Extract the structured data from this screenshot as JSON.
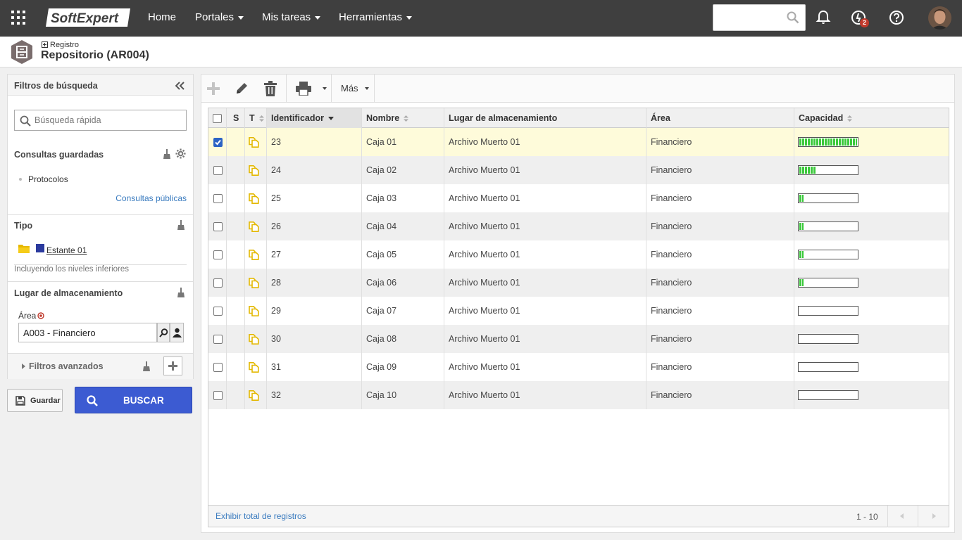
{
  "nav": {
    "logo": "SoftExpert",
    "items": [
      {
        "label": "Home",
        "dropdown": false
      },
      {
        "label": "Portales",
        "dropdown": true
      },
      {
        "label": "Mis tareas",
        "dropdown": true
      },
      {
        "label": "Herramientas",
        "dropdown": true
      }
    ],
    "search_value": "",
    "task_badge": "2"
  },
  "header": {
    "breadcrumb": "Registro",
    "title": "Repositorio (AR004)"
  },
  "sidebar": {
    "title": "Filtros de búsqueda",
    "quick_search_placeholder": "Búsqueda rápida",
    "saved_queries": {
      "title": "Consultas guardadas",
      "items": [
        "Protocolos"
      ],
      "public_link": "Consultas públicas"
    },
    "type": {
      "title": "Tipo",
      "item": "Estante 01",
      "item_color": "#2b3a9e",
      "note": "Incluyendo los niveles inferiores"
    },
    "storage": {
      "title": "Lugar de almacenamiento",
      "area_label": "Área",
      "area_value": "A003 - Financiero"
    },
    "advanced": "Filtros avanzados"
  },
  "buttons": {
    "save": "Guardar",
    "search": "BUSCAR"
  },
  "toolbar": {
    "more": "Más"
  },
  "grid": {
    "headers": {
      "s": "S",
      "t": "T",
      "id": "Identificador",
      "name": "Nombre",
      "location": "Lugar de almacenamiento",
      "area": "Área",
      "capacity": "Capacidad"
    },
    "rows": [
      {
        "checked": true,
        "id": "23",
        "name": "Caja 01",
        "location": "Archivo Muerto 01",
        "area": "Financiero",
        "capacity": 1.0
      },
      {
        "checked": false,
        "id": "24",
        "name": "Caja 02",
        "location": "Archivo Muerto 01",
        "area": "Financiero",
        "capacity": 0.28
      },
      {
        "checked": false,
        "id": "25",
        "name": "Caja 03",
        "location": "Archivo Muerto 01",
        "area": "Financiero",
        "capacity": 0.07
      },
      {
        "checked": false,
        "id": "26",
        "name": "Caja 04",
        "location": "Archivo Muerto 01",
        "area": "Financiero",
        "capacity": 0.07
      },
      {
        "checked": false,
        "id": "27",
        "name": "Caja 05",
        "location": "Archivo Muerto 01",
        "area": "Financiero",
        "capacity": 0.07
      },
      {
        "checked": false,
        "id": "28",
        "name": "Caja 06",
        "location": "Archivo Muerto 01",
        "area": "Financiero",
        "capacity": 0.07
      },
      {
        "checked": false,
        "id": "29",
        "name": "Caja 07",
        "location": "Archivo Muerto 01",
        "area": "Financiero",
        "capacity": 0
      },
      {
        "checked": false,
        "id": "30",
        "name": "Caja 08",
        "location": "Archivo Muerto 01",
        "area": "Financiero",
        "capacity": 0
      },
      {
        "checked": false,
        "id": "31",
        "name": "Caja 09",
        "location": "Archivo Muerto 01",
        "area": "Financiero",
        "capacity": 0
      },
      {
        "checked": false,
        "id": "32",
        "name": "Caja 10",
        "location": "Archivo Muerto 01",
        "area": "Financiero",
        "capacity": 0
      }
    ],
    "footer_link": "Exhibir total de registros",
    "pager": "1 - 10"
  }
}
